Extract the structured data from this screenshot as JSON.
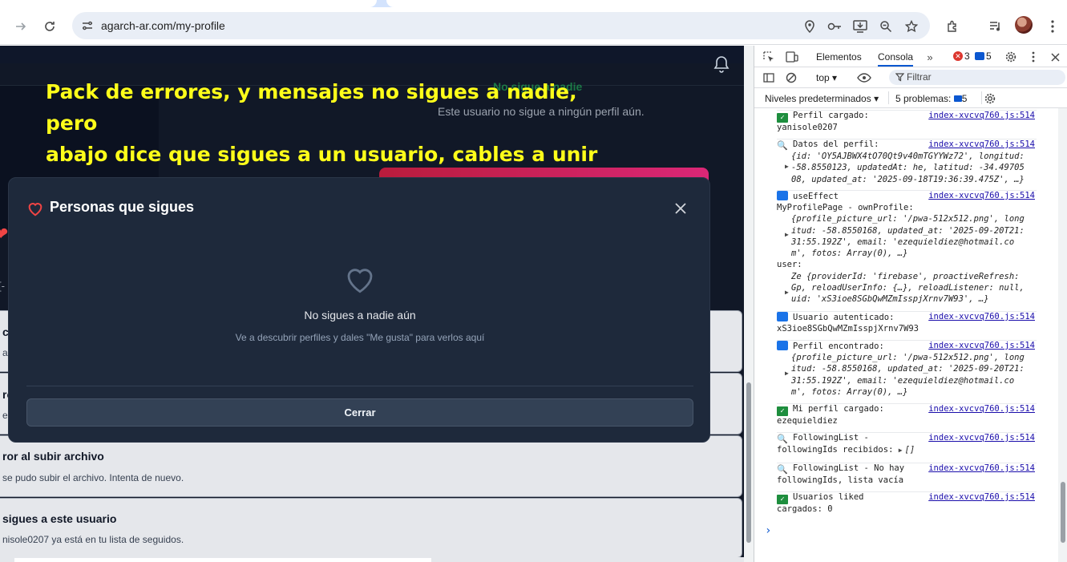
{
  "browser": {
    "url": "agarch-ar.com/my-profile"
  },
  "page": {
    "ghost_title": "No sigue a nadie",
    "ghost_subtitle": "Este usuario no sigue a ningún perfil aún.",
    "left_fragment": "[-",
    "toasts": [
      {
        "title": "c",
        "message": "ar"
      },
      {
        "title": "ro",
        "message": "eb"
      },
      {
        "title": "ror al subir archivo",
        "message": "se pudo subir el archivo. Intenta de nuevo."
      },
      {
        "title": "sigues a este usuario",
        "message": "nisole0207 ya está en tu lista de seguidos."
      }
    ]
  },
  "annotation": {
    "line1": "Pack de errores, y mensajes no sigues a nadie, pero",
    "line2": "abajo dice que sigues a un usuario, cables a unir"
  },
  "modal": {
    "title": "Personas que sigues",
    "empty_title": "No sigues a nadie aún",
    "empty_subtitle": "Ve a descubrir perfiles y dales \"Me gusta\" para verlos aquí",
    "close_button": "Cerrar"
  },
  "devtools": {
    "tabs": {
      "elements": "Elementos",
      "console": "Consola"
    },
    "error_count": "3",
    "message_count": "5",
    "context": "top",
    "filter_placeholder": "Filtrar",
    "levels": "Niveles predeterminados",
    "problems_label": "5 problemas:",
    "problems_count": "5",
    "entries": {
      "e0_src": "index-xvcvq760.js:514",
      "e1_title": "Perfil cargado:",
      "e1_value": "yanisole0207",
      "e2_title": "Datos del perfil:",
      "e2_obj1": "{id: 'OY5AJBWX4tO70Qt9v40mTGYYWz72', longitud:",
      "e2_obj2": "-58.8550123, updatedAt: he, latitud: -34.49705",
      "e2_obj3": "08, updated_at: '2025-09-18T19:36:39.475Z', …}",
      "e3_title": "useEffect",
      "e3_line2": "MyProfilePage - ownProfile:",
      "e3_obj1": "{profile_picture_url: '/pwa-512x512.png', long",
      "e3_obj2": "itud: -58.8550168, updated_at: '2025-09-20T21:",
      "e3_obj3": "31:55.192Z', email: 'ezequieldiez@hotmail.co",
      "e3_obj4": "m', fotos: Array(0), …}",
      "e3_user": "user:",
      "e3_obj5": "Ze {providerId: 'firebase', proactiveRefresh:",
      "e3_obj6": "Gp, reloadUserInfo: {…}, reloadListener: null,",
      "e3_obj7": "uid: 'xS3ioe8SGbQwMZmIsspjXrnv7W93', …}",
      "e4_title": "Usuario autenticado:",
      "e4_value": "xS3ioe8SGbQwMZmIsspjXrnv7W93",
      "e5_title": "Perfil encontrado:",
      "e5_obj1": "{profile_picture_url: '/pwa-512x512.png', long",
      "e5_obj2": "itud: -58.8550168, updated_at: '2025-09-20T21:",
      "e5_obj3": "31:55.192Z', email: 'ezequieldiez@hotmail.co",
      "e5_obj4": "m', fotos: Array(0), …}",
      "e6_title": "Mi perfil cargado:",
      "e6_value": "ezequieldiez",
      "e7_title": "FollowingList -",
      "e7_line2": "followingIds recibidos:",
      "e7_arr": "[]",
      "e8_title": "FollowingList - No hay",
      "e8_line2": "followingIds, lista vacía",
      "e9_title": "Usuarios liked",
      "e9_line2": "cargados: 0"
    }
  }
}
